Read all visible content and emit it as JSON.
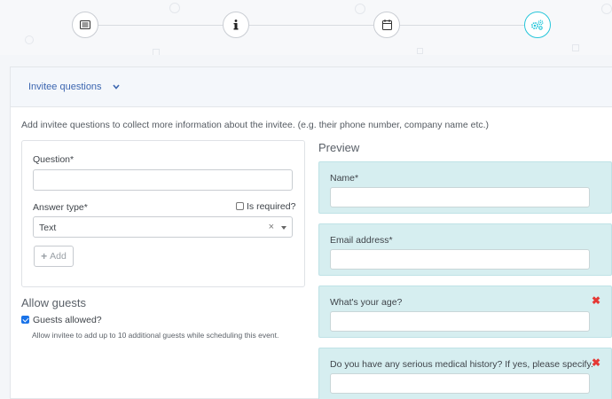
{
  "stepper": {
    "steps": [
      {
        "name": "details",
        "icon": "list-icon",
        "active": false
      },
      {
        "name": "info",
        "icon": "info-icon",
        "active": false
      },
      {
        "name": "schedule",
        "icon": "calendar-icon",
        "active": false
      },
      {
        "name": "settings",
        "icon": "gears-icon",
        "active": true
      }
    ],
    "active_color": "#26c6da"
  },
  "header": {
    "title": "Invitee questions"
  },
  "intro_text": "Add invitee questions to collect more information about the invitee. (e.g. their phone number, company name etc.)",
  "form": {
    "question_label": "Question*",
    "question_value": "",
    "answer_type_label": "Answer type*",
    "is_required_label": "Is required?",
    "is_required_checked": false,
    "answer_type_value": "Text",
    "clear_symbol": "×",
    "add_label": "Add"
  },
  "guests": {
    "title": "Allow guests",
    "checkbox_label": "Guests allowed?",
    "checked": true,
    "help": "Allow invitee to add up to 10 additional guests while scheduling this event."
  },
  "preview": {
    "title": "Preview",
    "delete_symbol": "✖",
    "questions": [
      {
        "label": "Name*",
        "deletable": false
      },
      {
        "label": "Email address*",
        "deletable": false
      },
      {
        "label": "What's your age?",
        "deletable": true
      },
      {
        "label": "Do you have any serious medical history? If yes, please specify.",
        "deletable": true
      }
    ]
  },
  "colors": {
    "accent": "#3c66b0",
    "preview_bg": "#d6eef0",
    "delete": "#e53935",
    "checkbox": "#1a73e8"
  }
}
